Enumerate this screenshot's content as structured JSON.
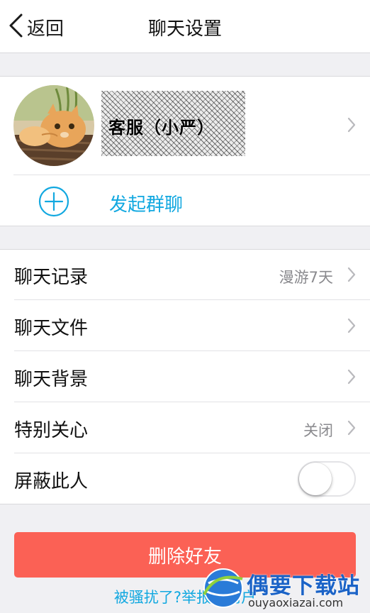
{
  "nav": {
    "back_label": "返回",
    "title": "聊天设置"
  },
  "profile": {
    "nickname": "客服（小严）",
    "start_group_chat": "发起群聊"
  },
  "settings": {
    "rows": [
      {
        "label": "聊天记录",
        "value": "漫游7天"
      },
      {
        "label": "聊天文件",
        "value": ""
      },
      {
        "label": "聊天背景",
        "value": ""
      },
      {
        "label": "特别关心",
        "value": "关闭"
      },
      {
        "label": "屏蔽此人",
        "toggle_on": false
      }
    ]
  },
  "actions": {
    "delete_friend": "删除好友",
    "report_link": "被骚扰了?举报该用户"
  },
  "watermark": {
    "brand": "偶要下载站",
    "url": "ouyaoxiazai.com"
  },
  "colors": {
    "accent": "#12a8e0",
    "danger": "#fb6155",
    "background": "#f0f0f3"
  },
  "icons": [
    "chevron-left-icon",
    "chevron-right-icon",
    "add-circle-icon",
    "globe-logo-icon"
  ]
}
